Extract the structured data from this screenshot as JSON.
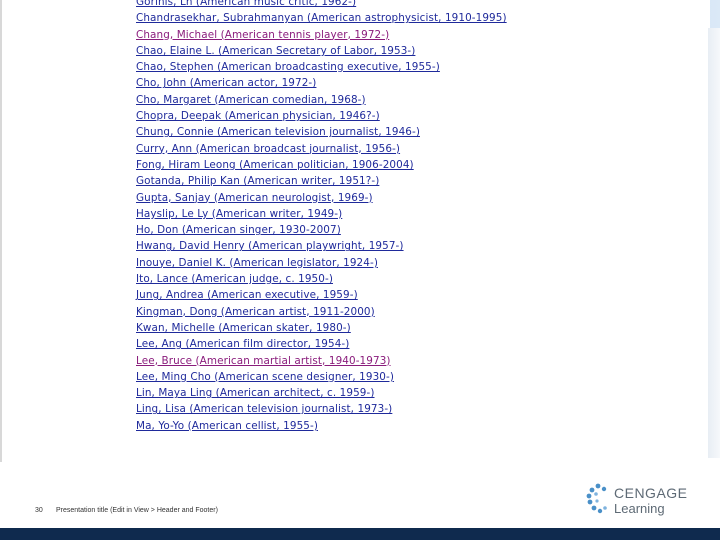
{
  "list": {
    "items": [
      "Gorinis, Ln (American music critic, 1962-)",
      "Chandrasekhar, Subrahmanyan (American astrophysicist, 1910-1995)",
      "Chang, Michael (American tennis player, 1972-)",
      "Chao, Elaine L. (American Secretary of Labor, 1953-)",
      "Chao, Stephen (American broadcasting executive, 1955-)",
      "Cho, John (American actor, 1972-)",
      "Cho, Margaret (American comedian, 1968-)",
      "Chopra, Deepak (American physician, 1946?-)",
      "Chung, Connie (American television journalist, 1946-)",
      "Curry, Ann (American broadcast journalist, 1956-)",
      "Fong, Hiram Leong (American politician, 1906-2004)",
      "Gotanda, Philip Kan (American writer, 1951?-)",
      "Gupta, Sanjay (American neurologist, 1969-)",
      "Hayslip, Le Ly (American writer, 1949-)",
      "Ho, Don (American singer, 1930-2007)",
      "Hwang, David Henry (American playwright, 1957-)",
      "Inouye, Daniel K. (American legislator, 1924-)",
      "Ito, Lance (American judge, c. 1950-)",
      "Jung, Andrea (American executive, 1959-)",
      "Kingman, Dong (American artist, 1911-2000)",
      "Kwan, Michelle (American skater, 1980-)",
      "Lee, Ang (American film director, 1954-)",
      "Lee, Bruce (American martial artist, 1940-1973)",
      "Lee, Ming Cho (American scene designer, 1930-)",
      "Lin, Maya Ling (American architect, c. 1959-)",
      "Ling, Lisa (American television journalist, 1973-)",
      "Ma, Yo-Yo (American cellist, 1955-)"
    ]
  },
  "footer": {
    "slide_number": "30",
    "title": "Presentation title (Edit in View > Header and Footer)"
  },
  "logo": {
    "line1": "CENGAGE",
    "line2": "Learning"
  },
  "colors": {
    "link": "#1f2a9b",
    "visited_link": "#8a1c7c",
    "bottom_bar": "#0f2a4e",
    "logo_blue": "#4a90c8"
  }
}
